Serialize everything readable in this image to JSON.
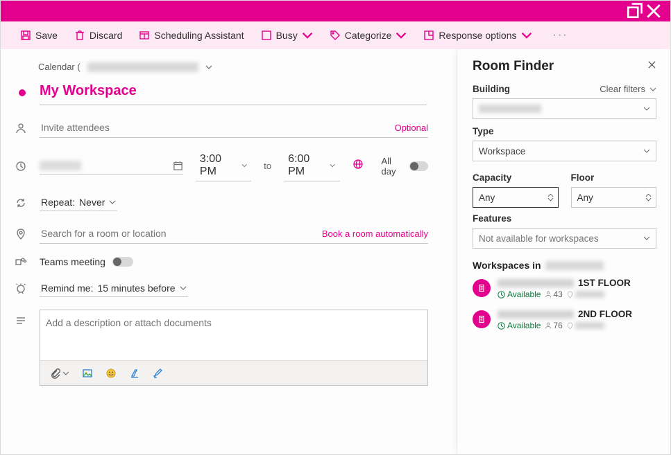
{
  "toolbar": {
    "save": "Save",
    "discard": "Discard",
    "scheduling_assistant": "Scheduling Assistant",
    "busy": "Busy",
    "categorize": "Categorize",
    "response_options": "Response options"
  },
  "calendar_breadcrumb": "Calendar (",
  "event_title": "My Workspace",
  "attendees_placeholder": "Invite attendees",
  "optional_label": "Optional",
  "start_time": "3:00 PM",
  "time_to": "to",
  "end_time": "6:00 PM",
  "all_day_label": "All day",
  "repeat_label": "Repeat:",
  "repeat_value": "Never",
  "location_placeholder": "Search for a room or location",
  "book_auto": "Book a room automatically",
  "teams_label": "Teams meeting",
  "remind_label": "Remind me:",
  "remind_value": "15 minutes before",
  "description_placeholder": "Add a description or attach documents",
  "room_finder": {
    "title": "Room Finder",
    "building_label": "Building",
    "clear_filters": "Clear filters",
    "type_label": "Type",
    "type_value": "Workspace",
    "capacity_label": "Capacity",
    "capacity_value": "Any",
    "floor_label": "Floor",
    "floor_value": "Any",
    "features_label": "Features",
    "features_value": "Not available for workspaces",
    "workspaces_in": "Workspaces in",
    "results": [
      {
        "floor_suffix": "1ST FLOOR",
        "status": "Available",
        "capacity": "43"
      },
      {
        "floor_suffix": "2ND FLOOR",
        "status": "Available",
        "capacity": "76"
      }
    ]
  }
}
